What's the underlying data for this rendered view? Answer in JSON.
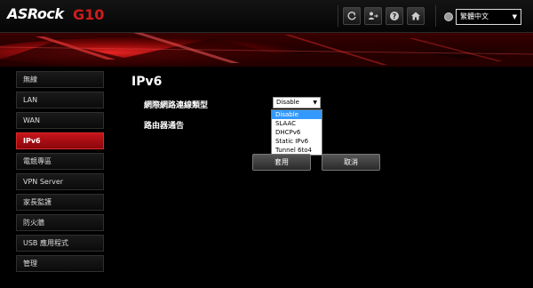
{
  "header": {
    "brand": "ASRock",
    "model": "G10",
    "language": "繁體中文"
  },
  "sidebar": {
    "items": [
      {
        "label": "無線",
        "active": false
      },
      {
        "label": "LAN",
        "active": false
      },
      {
        "label": "WAN",
        "active": false
      },
      {
        "label": "IPv6",
        "active": true
      },
      {
        "label": "電競專區",
        "active": false
      },
      {
        "label": "VPN Server",
        "active": false
      },
      {
        "label": "家長監護",
        "active": false
      },
      {
        "label": "防火牆",
        "active": false
      },
      {
        "label": "USB 應用程式",
        "active": false
      },
      {
        "label": "管理",
        "active": false
      }
    ]
  },
  "main": {
    "title": "IPv6",
    "connection_type_label": "網際網路連線類型",
    "router_advert_label": "路由器通告",
    "connection_type_value": "Disable",
    "options": [
      "Disable",
      "SLAAC",
      "DHCPv6",
      "Static IPv6",
      "Tunnel 6to4"
    ],
    "apply_label": "套用",
    "cancel_label": "取消"
  },
  "colors": {
    "accent": "#c4141a",
    "background": "#000000"
  }
}
